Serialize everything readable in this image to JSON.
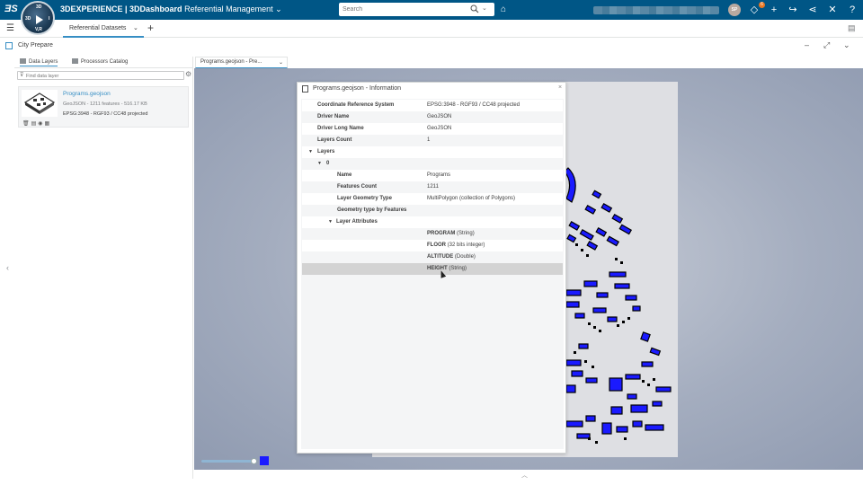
{
  "topbar": {
    "brand_bold": "3DEXPERIENCE | 3DDashboard",
    "brand_app": "Referential Management",
    "compass_north": "3D",
    "compass_south": "V,R",
    "compass_west": "3D",
    "compass_east": "I",
    "search_placeholder": "Search",
    "avatar_initials": "SP",
    "notification_count": "6"
  },
  "tabbar": {
    "active_tab": "Referential Datasets"
  },
  "widget": {
    "title": "City Prepare"
  },
  "left_panel": {
    "tabs": [
      {
        "label": "Data Layers"
      },
      {
        "label": "Processors Catalog"
      }
    ],
    "find_placeholder": "Find data layer",
    "layer": {
      "name": "Programs.geojson",
      "meta": "GeoJSON - 1211 features - 516.17 KB",
      "projection": "EPSG:3948 - RGF93 / CC48 projected"
    }
  },
  "map": {
    "tab_label": "Programs.geojson - Pre..."
  },
  "dialog": {
    "title": "Programs.geojson - Information",
    "rows": [
      {
        "key": "Coordinate Reference System",
        "value": "EPSG:3948 - RGF93 / CC48 projected"
      },
      {
        "key": "Driver Name",
        "value": "GeoJSON"
      },
      {
        "key": "Driver Long Name",
        "value": "GeoJSON"
      },
      {
        "key": "Layers Count",
        "value": "1"
      },
      {
        "key": "Layers",
        "value": ""
      },
      {
        "key": "0",
        "value": ""
      },
      {
        "key": "Name",
        "value": "Programs"
      },
      {
        "key": "Features Count",
        "value": "1211"
      },
      {
        "key": "Layer Geometry Type",
        "value": "MultiPolygon (collection of Polygons)"
      },
      {
        "key": "Geometry type by Features",
        "value": ""
      },
      {
        "key": "Layer Attributes",
        "value": ""
      }
    ],
    "attributes": [
      {
        "name": "PROGRAM",
        "type": "(String)"
      },
      {
        "name": "FLOOR",
        "type": "(32 bits integer)"
      },
      {
        "name": "ALTITUDE",
        "type": "(Double)"
      },
      {
        "name": "HEIGHT",
        "type": "(String)"
      }
    ]
  },
  "colors": {
    "topbar": "#005686",
    "accent": "#368ec4",
    "map_buildings": "#1a1aff"
  }
}
